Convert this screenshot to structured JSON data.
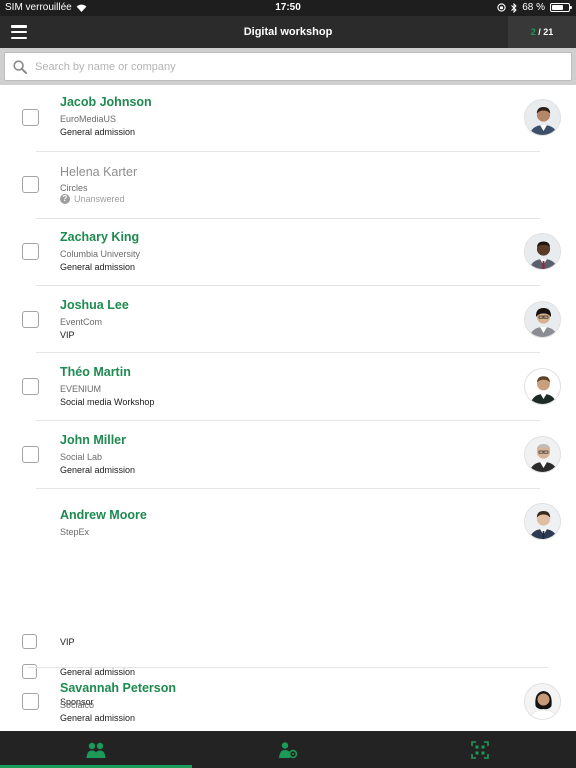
{
  "status_bar": {
    "carrier": "SIM verrouillée",
    "time": "17:50",
    "battery": "68 %",
    "battery_level": 0.68
  },
  "nav": {
    "title": "Digital workshop",
    "counter_current": "2",
    "counter_total": "/ 21"
  },
  "search": {
    "placeholder": "Search by name or company",
    "value": ""
  },
  "attendees": [
    {
      "name": "Jacob Johnson",
      "company": "EuroMediaUS",
      "category": "General admission",
      "checked": false,
      "avatar": "avatar-photo"
    },
    {
      "name": "Helena Karter",
      "company": "Circles",
      "status": "Unanswered",
      "checked": false
    },
    {
      "name": "Zachary King",
      "company": "Columbia University",
      "category": "General admission",
      "checked": false,
      "avatar": "avatar-photo"
    },
    {
      "name": "Joshua Lee",
      "company": "EventCom",
      "category": "VIP",
      "checked": false,
      "avatar": "avatar-photo"
    },
    {
      "name": "Théo Martin",
      "company": "EVENIUM",
      "category": "Social media Workshop",
      "checked": false,
      "avatar": "avatar-photo"
    },
    {
      "name": "John Miller",
      "company": "Social Lab",
      "category": "General admission",
      "checked": false,
      "avatar": "avatar-photo"
    },
    {
      "name": "Andrew Moore",
      "company": "StepEx",
      "options": [
        "VIP",
        "General admission",
        "Sponsor"
      ],
      "checked": false,
      "avatar": "avatar-photo"
    },
    {
      "name": "Savannah Peterson",
      "company": "Socialco",
      "category": "General admission",
      "checked": false,
      "avatar": "avatar-photo"
    }
  ],
  "tabs": [
    {
      "icon": "attendees-icon",
      "active": true
    },
    {
      "icon": "person-settings-icon",
      "active": false
    },
    {
      "icon": "qr-scan-icon",
      "active": false
    }
  ],
  "colors": {
    "accent": "#1c9a57",
    "nav_bg": "#2b2b2b",
    "tab_bg": "#232323"
  }
}
